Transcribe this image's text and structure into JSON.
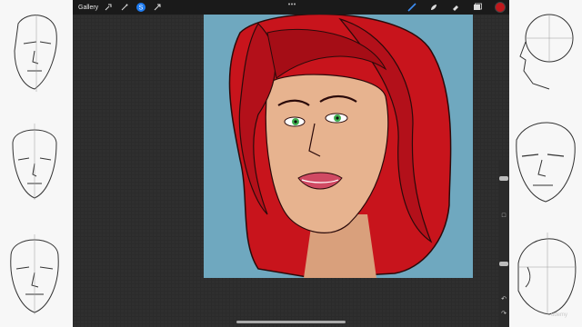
{
  "toolbar": {
    "gallery_label": "Gallery",
    "left_icons": [
      "wrench-icon",
      "magic-wand-icon",
      "selection-icon",
      "transform-arrow-icon"
    ],
    "right_icons": [
      "brush-icon",
      "smudge-icon",
      "eraser-icon",
      "layers-icon"
    ],
    "active_color": "#c0181c"
  },
  "canvas": {
    "background_color": "#6fa8bf",
    "hair_color": "#c8141c",
    "skin_color": "#e7b38f"
  },
  "side_controls": {
    "modify_button": "□",
    "undo_icon": "↶",
    "redo_icon": "↷"
  },
  "watermark": "udemy"
}
